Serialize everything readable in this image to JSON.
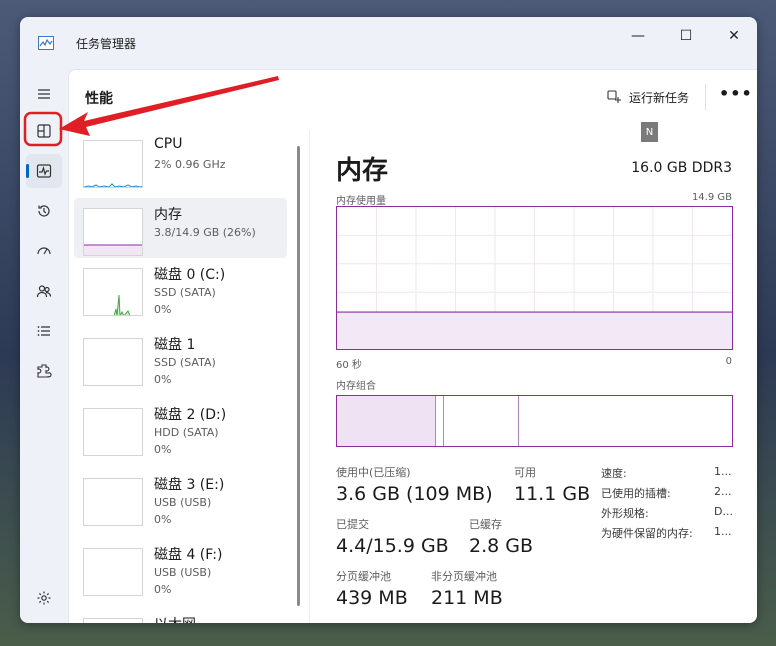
{
  "window": {
    "title": "任务管理器",
    "controls": {
      "minimize": "—",
      "maximize": "☐",
      "close": "✕"
    }
  },
  "nav": {
    "items": [
      {
        "icon": "hamburger-menu-icon"
      },
      {
        "icon": "processes-icon",
        "highlighted": true
      },
      {
        "icon": "performance-icon",
        "active": true
      },
      {
        "icon": "app-history-icon"
      },
      {
        "icon": "startup-apps-icon"
      },
      {
        "icon": "users-icon"
      },
      {
        "icon": "details-icon"
      },
      {
        "icon": "services-icon"
      }
    ],
    "settings_icon": "gear-icon"
  },
  "header": {
    "title": "性能",
    "run_task_label": "运行新任务",
    "more_label": "•••",
    "badge": "N"
  },
  "devices": [
    {
      "name": "CPU",
      "sub": "2% 0.96 GHz",
      "value": ""
    },
    {
      "name": "内存",
      "sub": "3.8/14.9 GB (26%)",
      "value": "",
      "selected": true
    },
    {
      "name": "磁盘 0 (C:)",
      "sub": "SSD (SATA)",
      "value": "0%"
    },
    {
      "name": "磁盘 1",
      "sub": "SSD (SATA)",
      "value": "0%"
    },
    {
      "name": "磁盘 2 (D:)",
      "sub": "HDD (SATA)",
      "value": "0%"
    },
    {
      "name": "磁盘 3 (E:)",
      "sub": "USB (USB)",
      "value": "0%"
    },
    {
      "name": "磁盘 4 (F:)",
      "sub": "USB (USB)",
      "value": "0%"
    },
    {
      "name": "以太网",
      "sub": "",
      "value": ""
    }
  ],
  "detail": {
    "title": "内存",
    "spec": "16.0 GB DDR3",
    "usage_label": "内存使用量",
    "usage_max": "14.9 GB",
    "time_left": "60 秒",
    "time_right": "0",
    "composition_label": "内存组合",
    "stats": {
      "in_use_label": "使用中(已压缩)",
      "in_use_value": "3.6 GB (109 MB)",
      "available_label": "可用",
      "available_value": "11.1 GB",
      "committed_label": "已提交",
      "committed_value": "4.4/15.9 GB",
      "cached_label": "已缓存",
      "cached_value": "2.8 GB",
      "paged_label": "分页缓冲池",
      "paged_value": "439 MB",
      "nonpaged_label": "非分页缓冲池",
      "nonpaged_value": "211 MB"
    },
    "specs": [
      {
        "label": "速度:",
        "value": "1..."
      },
      {
        "label": "已使用的插槽:",
        "value": "2..."
      },
      {
        "label": "外形规格:",
        "value": "D..."
      },
      {
        "label": "为硬件保留的内存:",
        "value": "1..."
      }
    ],
    "memory_usage_fraction": 0.26,
    "composition": {
      "in_use_fraction": 0.25,
      "modified_fraction": 0.02,
      "standby_fraction": 0.19
    }
  },
  "colors": {
    "memory_accent": "#8a2b9e",
    "cpu_accent": "#1a8cc2",
    "disk_accent": "#3cab3c",
    "annotation": "#e01e25"
  }
}
